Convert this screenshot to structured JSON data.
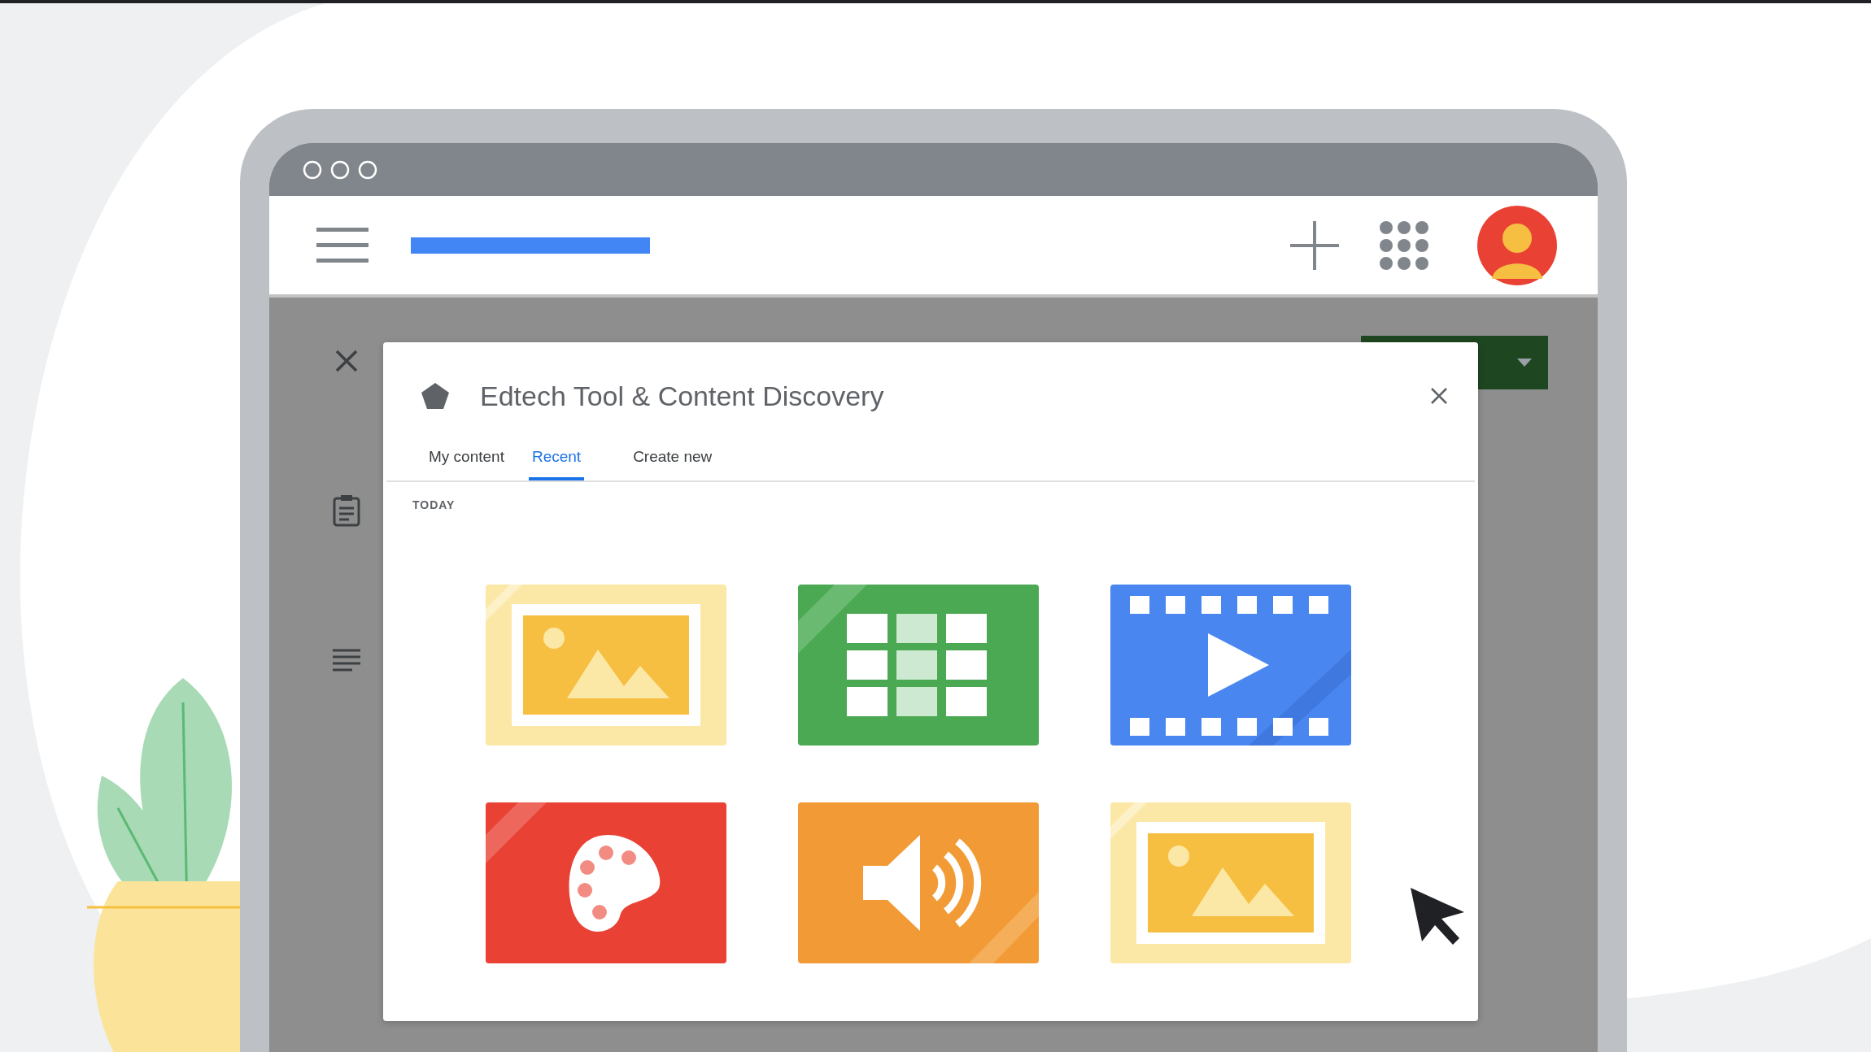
{
  "dialog": {
    "title": "Edtech Tool & Content Discovery",
    "tabs": [
      {
        "label": "My content",
        "selected": false
      },
      {
        "label": "Recent",
        "selected": true
      },
      {
        "label": "Create new",
        "selected": false
      }
    ],
    "section": "TODAY",
    "tiles": [
      {
        "kind": "image"
      },
      {
        "kind": "spreadsheet"
      },
      {
        "kind": "video"
      },
      {
        "kind": "art"
      },
      {
        "kind": "audio"
      },
      {
        "kind": "image"
      }
    ]
  }
}
